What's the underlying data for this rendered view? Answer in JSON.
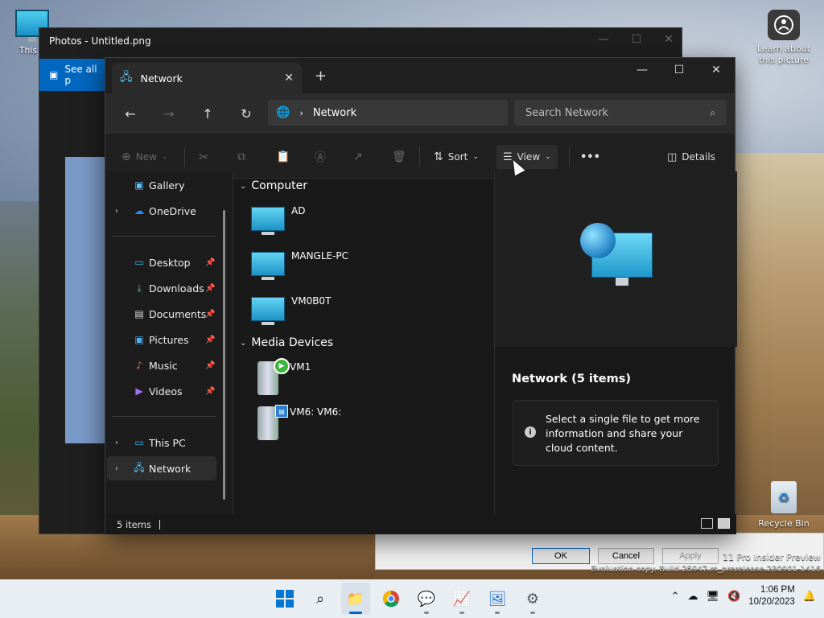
{
  "desktop": {
    "this_pc_label": "This P",
    "learn_label": "Learn about this picture",
    "recycle_label": "Recycle Bin",
    "watermark_line1": "11 Pro Insider Preview",
    "watermark_line2": "Evaluation copy. Build 25947.rs_prerelease.230901-1416"
  },
  "photos": {
    "title": "Photos - Untitled.png",
    "see_all": "See all p"
  },
  "dialog": {
    "ok": "OK",
    "cancel": "Cancel",
    "apply": "Apply"
  },
  "explorer": {
    "tab_title": "Network",
    "new_tab": "+",
    "address": "Network",
    "search_placeholder": "Search Network",
    "toolbar": {
      "new": "New",
      "sort": "Sort",
      "view": "View",
      "more": "•••",
      "details": "Details"
    },
    "nav": {
      "gallery": "Gallery",
      "onedrive": "OneDrive",
      "desktop": "Desktop",
      "downloads": "Downloads",
      "documents": "Documents",
      "pictures": "Pictures",
      "music": "Music",
      "videos": "Videos",
      "this_pc": "This PC",
      "network": "Network"
    },
    "groups": {
      "computer": "Computer",
      "media": "Media Devices"
    },
    "computers": [
      "AD",
      "MANGLE-PC",
      "VM0B0T"
    ],
    "media_devices": [
      "VM1",
      "VM6: VM6:"
    ],
    "details_pane": {
      "title": "Network (5 items)",
      "info": "Select a single file to get more information and share your cloud content."
    },
    "status": "5 items"
  },
  "taskbar": {
    "time": "1:06 PM",
    "date": "10/20/2023"
  }
}
